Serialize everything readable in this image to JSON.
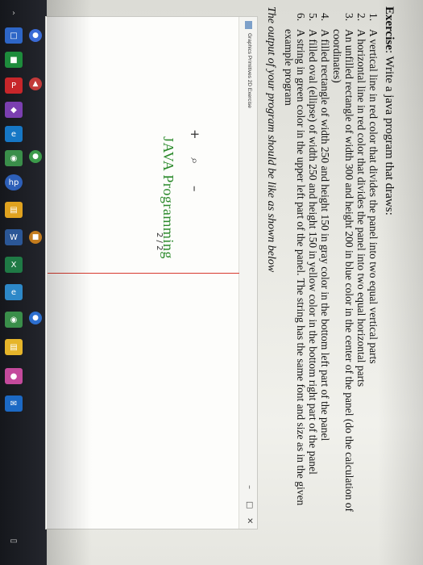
{
  "doc": {
    "title_label": "Exercise",
    "title_rest": ": Write a java program that draws:",
    "items": [
      {
        "num": "1.",
        "text": "A vertical line in red color that divides the panel into two equal vertical parts"
      },
      {
        "num": "2.",
        "text": "A horizontal line in red color that divides the panel into two equal horizontal parts"
      },
      {
        "num": "3.",
        "text": "An unfilled rectangle of width 300 and height 200 in blue color in the center of the panel (do the calculation of coordinates)"
      },
      {
        "num": "4.",
        "text": "A filled rectangle of width 250 and height 150 in gray color in the bottom left part of the panel"
      },
      {
        "num": "5.",
        "text": "A filled oval (ellipse) of width 250 and height 150 in yellow color in the bottom right part of the panel"
      },
      {
        "num": "6.",
        "text": "A string in green color in the upper left part of the panel. The string has the same font and size as in the given example program"
      }
    ],
    "output_note": "The output of your program should be like as shown below"
  },
  "window": {
    "title": "Graphics Primitives 2D Exercise",
    "minimize": "–",
    "maximize": "□",
    "close": "✕",
    "java_text": "JAVA Programming"
  },
  "viewer": {
    "plus": "+",
    "zoom": "⌕",
    "minus": "–",
    "page": "2  /  2"
  },
  "taskbar": {
    "icons": [
      "start-icon",
      "store-icon",
      "edge-icon",
      "powerpoint-icon",
      "app-icon",
      "chrome-icon",
      "hp-icon",
      "files-icon",
      "word-icon",
      "excel-icon",
      "chrome-icon",
      "folder-icon",
      "store-icon",
      "phone-icon",
      "chat-icon"
    ],
    "colors": {
      "accent": "#d83a2e",
      "green": "#2c8a2c"
    }
  }
}
